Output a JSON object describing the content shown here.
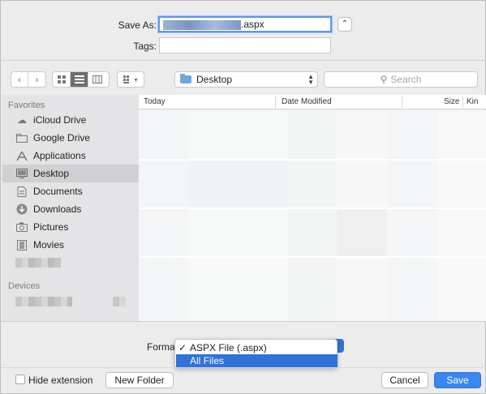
{
  "save_as": {
    "label": "Save As:",
    "filename_suffix": ".aspx",
    "tags_label": "Tags:",
    "tags_value": ""
  },
  "toolbar": {
    "location": "Desktop",
    "search_placeholder": "Search"
  },
  "sidebar": {
    "favorites_heading": "Favorites",
    "items": [
      {
        "label": "iCloud Drive",
        "icon": "cloud-icon"
      },
      {
        "label": "Google Drive",
        "icon": "folder-icon"
      },
      {
        "label": "Applications",
        "icon": "applications-icon"
      },
      {
        "label": "Desktop",
        "icon": "desktop-icon",
        "selected": true
      },
      {
        "label": "Documents",
        "icon": "document-icon"
      },
      {
        "label": "Downloads",
        "icon": "download-icon"
      },
      {
        "label": "Pictures",
        "icon": "camera-icon"
      },
      {
        "label": "Movies",
        "icon": "film-icon"
      }
    ],
    "devices_heading": "Devices"
  },
  "file_list": {
    "columns": [
      "Today",
      "Date Modified",
      "Size",
      "Kin"
    ]
  },
  "format": {
    "label": "Format",
    "options": [
      "ASPX File (.aspx)",
      "All Files"
    ],
    "checked_option": "ASPX File (.aspx)",
    "highlighted_option": "All Files"
  },
  "footer": {
    "hide_extension": "Hide extension",
    "new_folder": "New Folder",
    "cancel": "Cancel",
    "save": "Save"
  },
  "colors": {
    "accent": "#3a87f2",
    "highlight": "#2f73d8",
    "sidebar_bg": "#e4e4e6"
  }
}
